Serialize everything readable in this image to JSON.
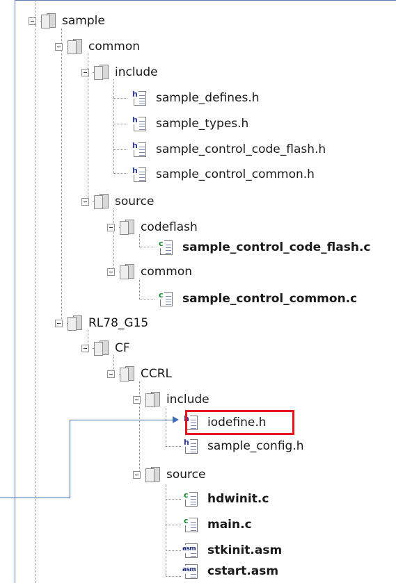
{
  "tree": {
    "sample": "sample",
    "common": "common",
    "common_include": "include",
    "sample_defines_h": "sample_defines.h",
    "sample_types_h": "sample_types.h",
    "sample_control_code_flash_h": "sample_control_code_flash.h",
    "sample_control_common_h": "sample_control_common.h",
    "common_source": "source",
    "codeflash": "codeflash",
    "sample_control_code_flash_c": "sample_control_code_flash.c",
    "source_common": "common",
    "sample_control_common_c": "sample_control_common.c",
    "rl78_g15": "RL78_G15",
    "cf": "CF",
    "ccrl": "CCRL",
    "ccrl_include": "include",
    "iodefine_h": "iodefine.h",
    "sample_config_h": "sample_config.h",
    "ccrl_source": "source",
    "hdwinit_c": "hdwinit.c",
    "main_c": "main.c",
    "stkinit_asm": "stkinit.asm",
    "cstart_asm": "cstart.asm"
  },
  "icons": {
    "header_tag": "h",
    "c_tag": "c",
    "asm_tag": "asm"
  },
  "colors": {
    "highlight": "#e8141e",
    "callout": "#3d6db5",
    "frame": "#5b7fb3"
  }
}
